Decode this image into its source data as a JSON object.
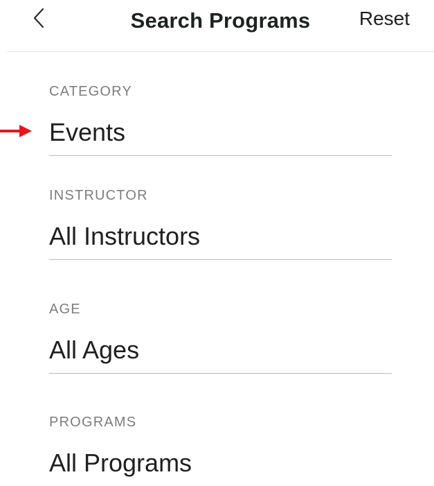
{
  "header": {
    "title": "Search Programs",
    "reset_label": "Reset",
    "back_icon": "chevron-left-icon"
  },
  "fields": [
    {
      "label": "CATEGORY",
      "value": "Events"
    },
    {
      "label": "INSTRUCTOR",
      "value": "All Instructors"
    },
    {
      "label": "AGE",
      "value": "All Ages"
    },
    {
      "label": "PROGRAMS",
      "value": "All Programs"
    }
  ],
  "annotation": {
    "icon": "red-arrow-right-icon",
    "color": "#e8141c"
  }
}
